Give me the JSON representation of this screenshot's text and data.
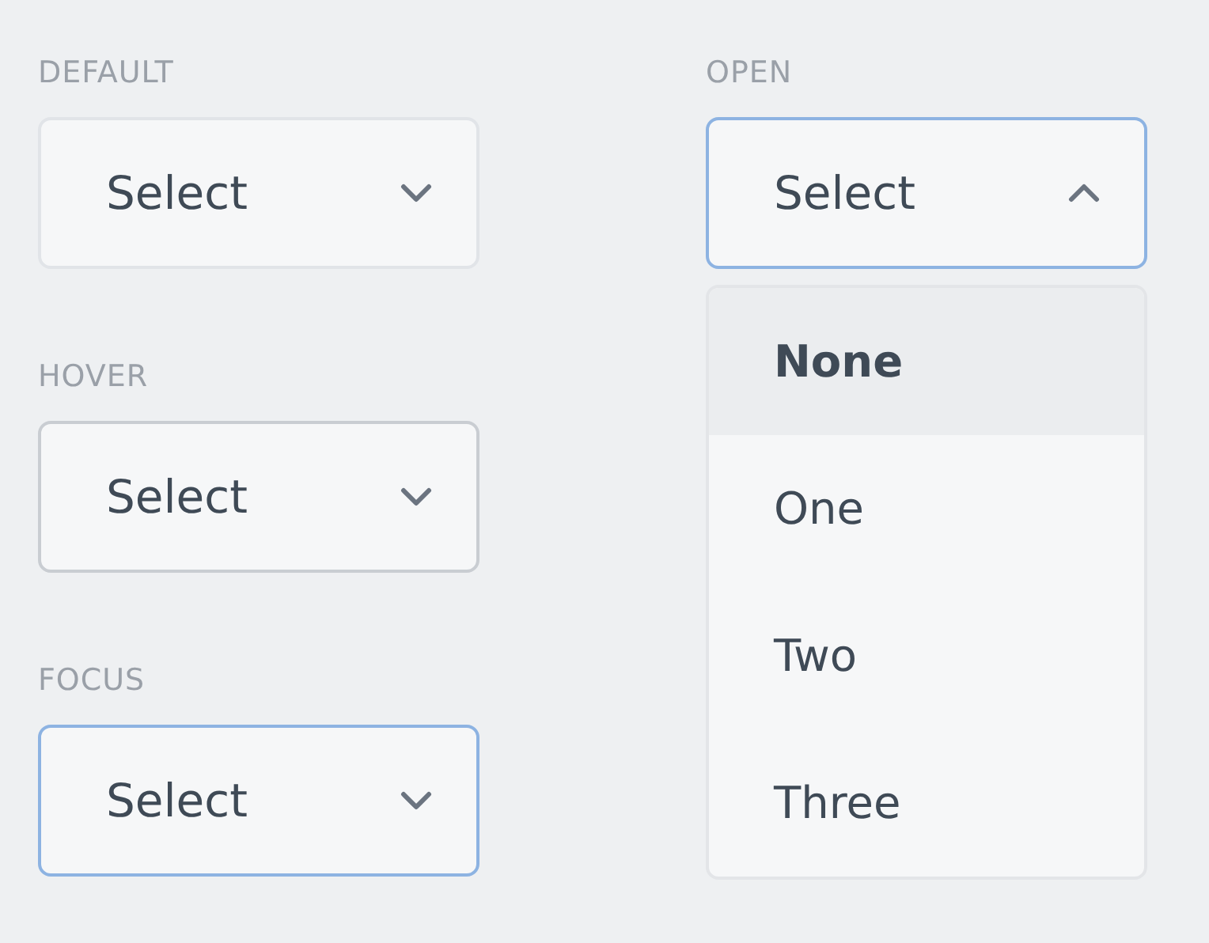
{
  "selects": [
    {
      "label": "DEFAULT",
      "value": "Select",
      "kind": "default",
      "expanded": false
    },
    {
      "label": "HOVER",
      "value": "Select",
      "kind": "hover",
      "expanded": false
    },
    {
      "label": "FOCUS",
      "value": "Select",
      "kind": "focus",
      "expanded": false
    }
  ],
  "open_select": {
    "label": "OPEN",
    "value": "Select",
    "kind": "focus",
    "expanded": true,
    "options": [
      {
        "label": "None",
        "selected": true
      },
      {
        "label": "One",
        "selected": false
      },
      {
        "label": "Two",
        "selected": false
      },
      {
        "label": "Three",
        "selected": false
      }
    ]
  }
}
